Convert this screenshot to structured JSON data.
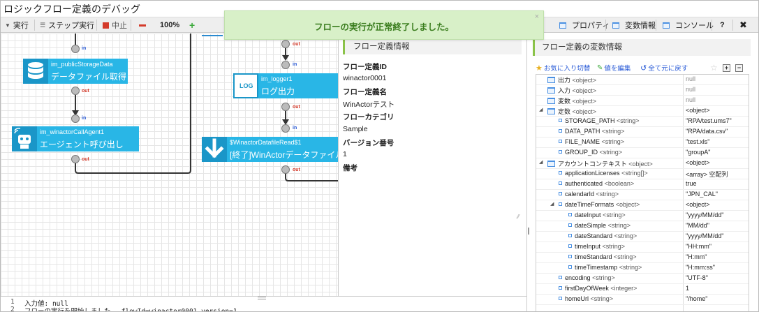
{
  "window": {
    "title": "ロジックフロー定義のデバッグ"
  },
  "toolbar": {
    "run": "実行",
    "step_run": "ステップ実行",
    "stop": "中止",
    "zoom": "100%",
    "properties": "プロパティ",
    "variables": "変数情報",
    "console": "コンソール",
    "help": "?"
  },
  "toast": {
    "message": "フローの実行が正常終了しました。",
    "close": "×"
  },
  "ports": {
    "in": "in",
    "out": "out"
  },
  "nodes": {
    "storage": {
      "name": "im_publicStorageData",
      "label": "データファイル取得"
    },
    "agent": {
      "name": "im_winactorCallAgent1",
      "label": "エージェント呼び出し"
    },
    "logger": {
      "name": "im_logger1",
      "label": "ログ出力",
      "icon_text": "LOG"
    },
    "read": {
      "name": "$WinactorDatafileRead$1",
      "label": "[終了]WinActorデータファイル読"
    }
  },
  "flow_info": {
    "header": "フロー定義情報",
    "id_label": "フロー定義ID",
    "id_value": "winactor0001",
    "name_label": "フロー定義名",
    "name_value": "WinActorテスト",
    "category_label": "フローカテゴリ",
    "category_value": "Sample",
    "version_label": "バージョン番号",
    "version_value": "1",
    "note_label": "備考"
  },
  "variables": {
    "header": "フロー定義の変数情報",
    "favorite": "お気に入り切替",
    "edit": "値を編集",
    "reset": "全て元に戻す",
    "rows": [
      {
        "name": "出力",
        "type": "<object>",
        "value": "null",
        "level": 0,
        "kind": "folder",
        "toggle": ""
      },
      {
        "name": "入力",
        "type": "<object>",
        "value": "null",
        "level": 0,
        "kind": "folder",
        "toggle": ""
      },
      {
        "name": "変数",
        "type": "<object>",
        "value": "null",
        "level": 0,
        "kind": "folder",
        "toggle": ""
      },
      {
        "name": "定数",
        "type": "<object>",
        "value": "<object>",
        "level": 0,
        "kind": "folder",
        "toggle": "◢"
      },
      {
        "name": "STORAGE_PATH",
        "type": "<string>",
        "value": "\"RPA/test.ums7\"",
        "level": 1,
        "kind": "leaf",
        "toggle": ""
      },
      {
        "name": "DATA_PATH",
        "type": "<string>",
        "value": "\"RPA/data.csv\"",
        "level": 1,
        "kind": "leaf",
        "toggle": ""
      },
      {
        "name": "FILE_NAME",
        "type": "<string>",
        "value": "\"test.xls\"",
        "level": 1,
        "kind": "leaf",
        "toggle": ""
      },
      {
        "name": "GROUP_ID",
        "type": "<string>",
        "value": "\"groupA\"",
        "level": 1,
        "kind": "leaf",
        "toggle": ""
      },
      {
        "name": "アカウントコンテキスト",
        "type": "<object>",
        "value": "<object>",
        "level": 0,
        "kind": "folder",
        "toggle": "◢"
      },
      {
        "name": "applicationLicenses",
        "type": "<string[]>",
        "value": "<array> 空配列",
        "level": 1,
        "kind": "leaf",
        "toggle": ""
      },
      {
        "name": "authenticated",
        "type": "<boolean>",
        "value": "true",
        "level": 1,
        "kind": "leaf",
        "toggle": ""
      },
      {
        "name": "calendarId",
        "type": "<string>",
        "value": "\"JPN_CAL\"",
        "level": 1,
        "kind": "leaf",
        "toggle": ""
      },
      {
        "name": "dateTimeFormats",
        "type": "<object>",
        "value": "<object>",
        "level": 1,
        "kind": "leaf",
        "toggle": "◢"
      },
      {
        "name": "dateInput",
        "type": "<string>",
        "value": "\"yyyy/MM/dd\"",
        "level": 2,
        "kind": "leaf",
        "toggle": ""
      },
      {
        "name": "dateSimple",
        "type": "<string>",
        "value": "\"MM/dd\"",
        "level": 2,
        "kind": "leaf",
        "toggle": ""
      },
      {
        "name": "dateStandard",
        "type": "<string>",
        "value": "\"yyyy/MM/dd\"",
        "level": 2,
        "kind": "leaf",
        "toggle": ""
      },
      {
        "name": "timeInput",
        "type": "<string>",
        "value": "\"HH:mm\"",
        "level": 2,
        "kind": "leaf",
        "toggle": ""
      },
      {
        "name": "timeStandard",
        "type": "<string>",
        "value": "\"H:mm\"",
        "level": 2,
        "kind": "leaf",
        "toggle": ""
      },
      {
        "name": "timeTimestamp",
        "type": "<string>",
        "value": "\"H:mm:ss\"",
        "level": 2,
        "kind": "leaf",
        "toggle": ""
      },
      {
        "name": "encoding",
        "type": "<string>",
        "value": "\"UTF-8\"",
        "level": 1,
        "kind": "leaf",
        "toggle": ""
      },
      {
        "name": "firstDayOfWeek",
        "type": "<integer>",
        "value": "1",
        "level": 1,
        "kind": "leaf",
        "toggle": ""
      },
      {
        "name": "homeUrl",
        "type": "<string>",
        "value": "\"/home\"",
        "level": 1,
        "kind": "leaf",
        "toggle": ""
      }
    ]
  },
  "console": {
    "lines": [
      {
        "num": "1",
        "text": "入力値: null"
      },
      {
        "num": "2",
        "text": "フローの実行を開始しました。 flowId=winactor0001 version=1"
      }
    ]
  },
  "colors": {
    "node": "#29b6e6",
    "node_icon": "#1a96c8",
    "success_bg": "#d8f0c8",
    "success_text": "#3a7d1e",
    "accent": "#8bc34a"
  }
}
